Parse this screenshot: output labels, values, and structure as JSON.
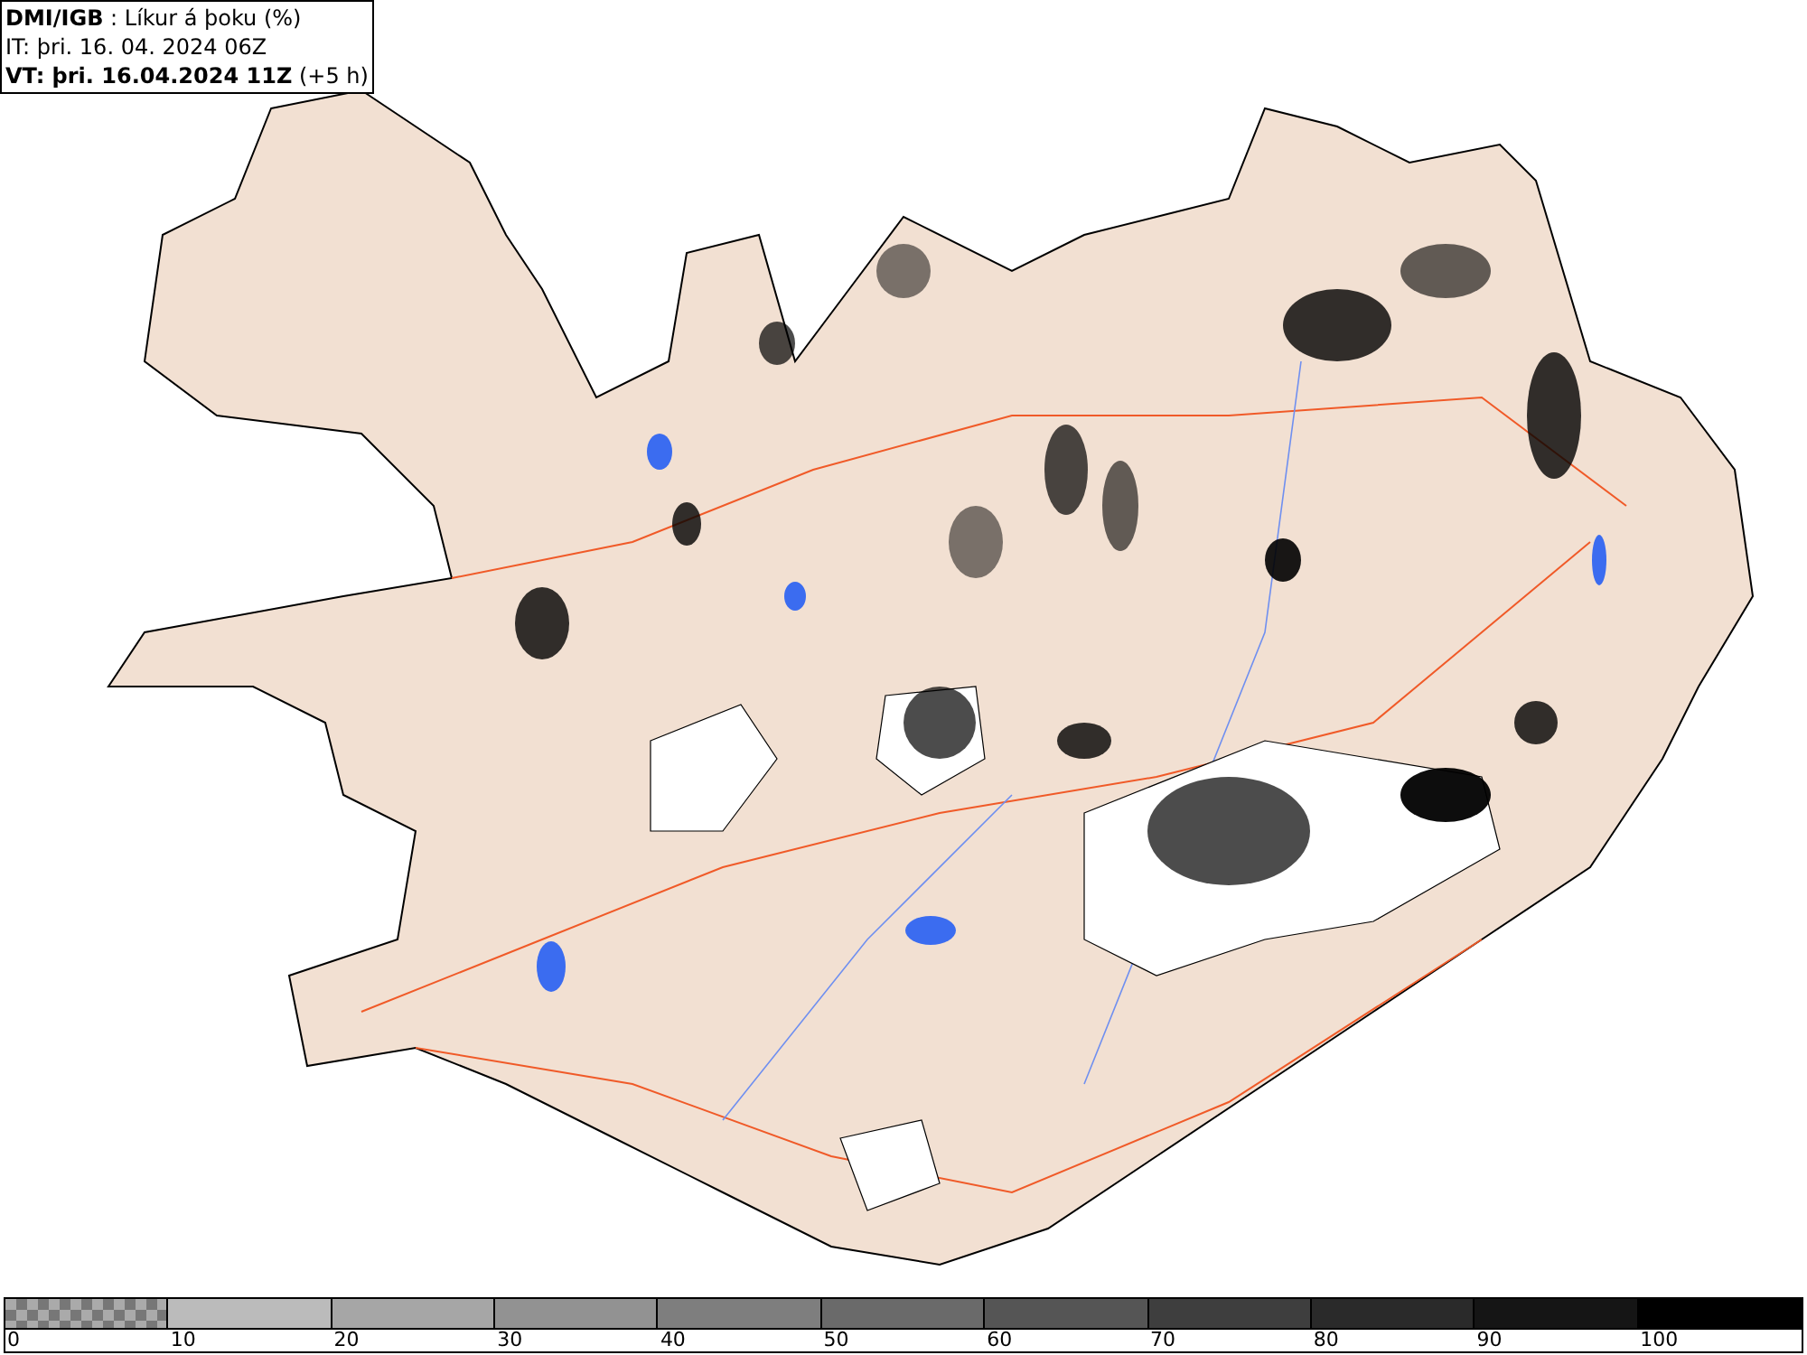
{
  "title_box": {
    "lines": [
      "**DMI/IGB** : Líkur á þoku (%)",
      "IT: þri. 16. 04. 2024 06Z",
      "**VT: þri. 16.04.2024 11Z** (+5 h)"
    ]
  },
  "legend": {
    "segments": [
      {
        "kind": "checker",
        "label": "0"
      },
      {
        "kind": "solid",
        "color": "#bbbbbb",
        "label": "10"
      },
      {
        "kind": "solid",
        "color": "#a6a6a6",
        "label": "20"
      },
      {
        "kind": "solid",
        "color": "#929292",
        "label": "30"
      },
      {
        "kind": "solid",
        "color": "#7e7e7e",
        "label": "40"
      },
      {
        "kind": "solid",
        "color": "#6a6a6a",
        "label": "50"
      },
      {
        "kind": "solid",
        "color": "#555555",
        "label": "60"
      },
      {
        "kind": "solid",
        "color": "#3e3e3e",
        "label": "70"
      },
      {
        "kind": "solid",
        "color": "#2a2a2a",
        "label": "80"
      },
      {
        "kind": "solid",
        "color": "#151515",
        "label": "90"
      },
      {
        "kind": "solid",
        "color": "#000000",
        "label": "100"
      }
    ]
  }
}
